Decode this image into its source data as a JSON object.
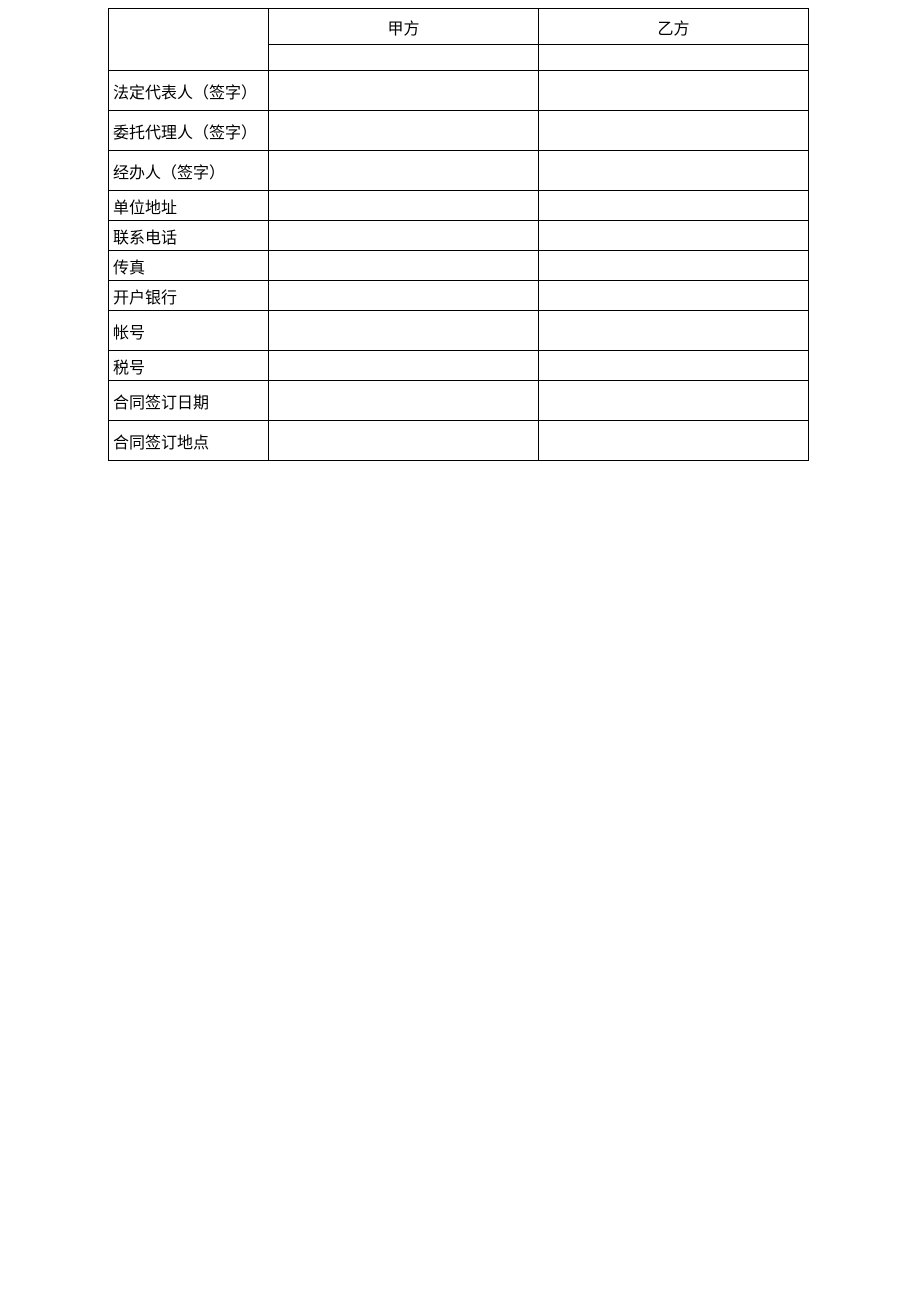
{
  "table": {
    "header": {
      "party_a": "甲方",
      "party_b": "乙方"
    },
    "rows": [
      {
        "label": "法定代表人（签字）",
        "a": "",
        "b": ""
      },
      {
        "label": "委托代理人（签字）",
        "a": "",
        "b": ""
      },
      {
        "label": "经办人（签字）",
        "a": "",
        "b": ""
      },
      {
        "label": "单位地址",
        "a": "",
        "b": ""
      },
      {
        "label": "联系电话",
        "a": "",
        "b": ""
      },
      {
        "label": "传真",
        "a": "",
        "b": ""
      },
      {
        "label": "开户银行",
        "a": "",
        "b": ""
      },
      {
        "label": "帐号",
        "a": "",
        "b": ""
      },
      {
        "label": "税号",
        "a": "",
        "b": ""
      },
      {
        "label": "合同签订日期",
        "a": "",
        "b": ""
      },
      {
        "label": "合同签订地点",
        "a": "",
        "b": ""
      }
    ]
  }
}
